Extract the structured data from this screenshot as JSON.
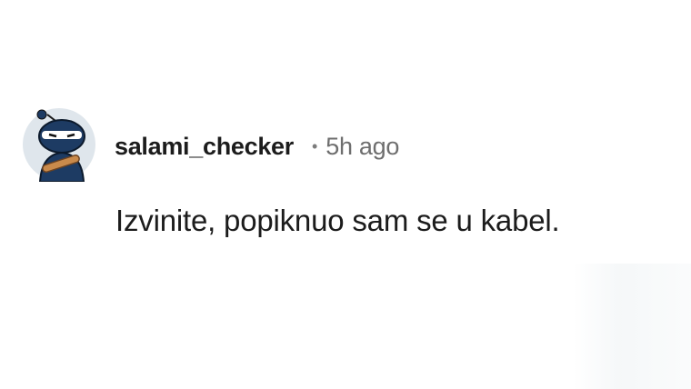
{
  "comment": {
    "avatar_icon": "snoo-avatar-icon",
    "username": "salami_checker",
    "separator": "•",
    "timestamp": "5h ago",
    "text": "Izvinite, popiknuo sam se u kabel."
  },
  "colors": {
    "username": "#1c1c1c",
    "timestamp": "#6e6e6e",
    "avatar_body": "#1d3b63",
    "background": "#ffffff"
  }
}
